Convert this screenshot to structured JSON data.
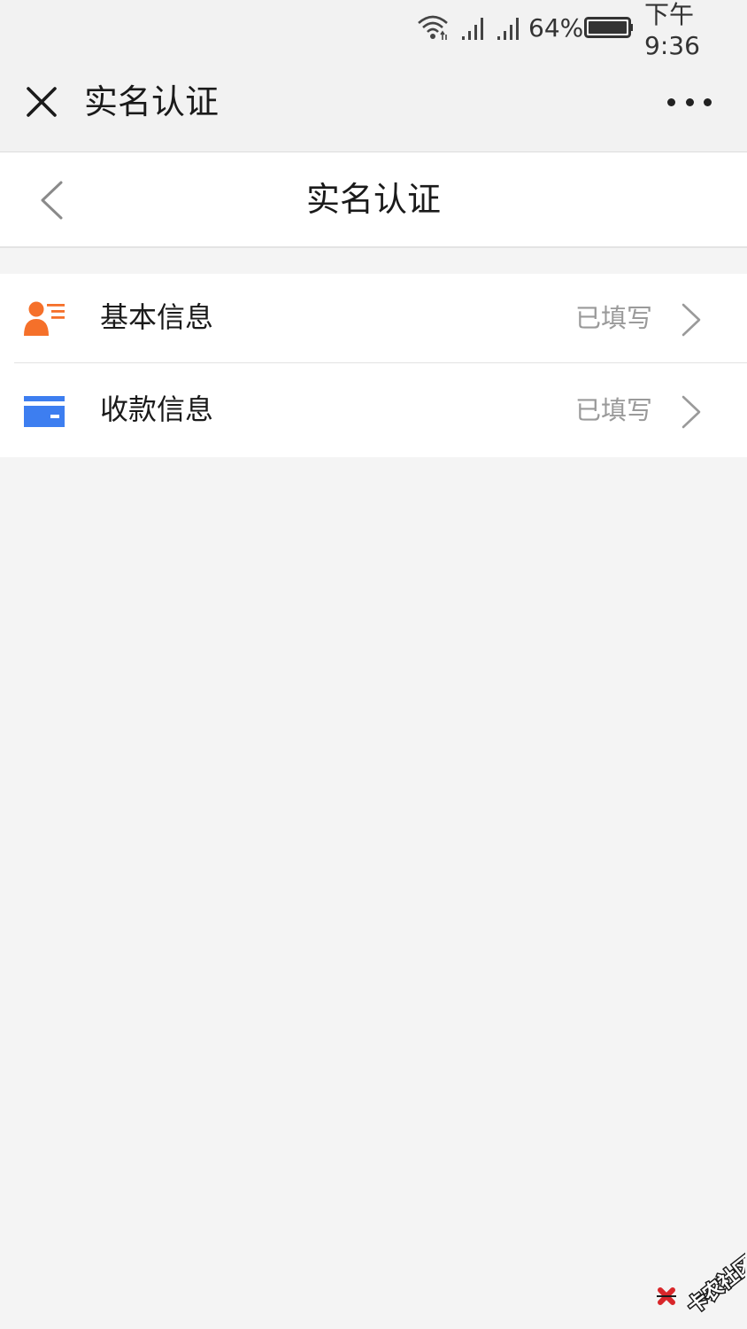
{
  "status_bar": {
    "battery_percent": "64%",
    "battery_level": 0.64,
    "time": "下午9:36",
    "icons": [
      "wifi-icon",
      "signal-1-icon",
      "signal-2-icon",
      "battery-icon"
    ]
  },
  "top_bar": {
    "title": "实名认证",
    "icons": [
      "close-icon",
      "more-dots-icon"
    ]
  },
  "header": {
    "title": "实名认证",
    "icons": [
      "back-chevron-icon"
    ]
  },
  "list": {
    "items": [
      {
        "label": "基本信息",
        "status": "已填写",
        "icon": "user-profile-icon",
        "icon_color": "#f5702a"
      },
      {
        "label": "收款信息",
        "status": "已填写",
        "icon": "bank-card-icon",
        "icon_color": "#3d7ef0"
      }
    ]
  },
  "watermark": {
    "text": "卡农社区",
    "icon": "kanong-logo-icon",
    "color": "#d8262a"
  },
  "colors": {
    "background": "#f4f4f4",
    "card": "#ffffff",
    "status_text": "#9a9a9a"
  }
}
